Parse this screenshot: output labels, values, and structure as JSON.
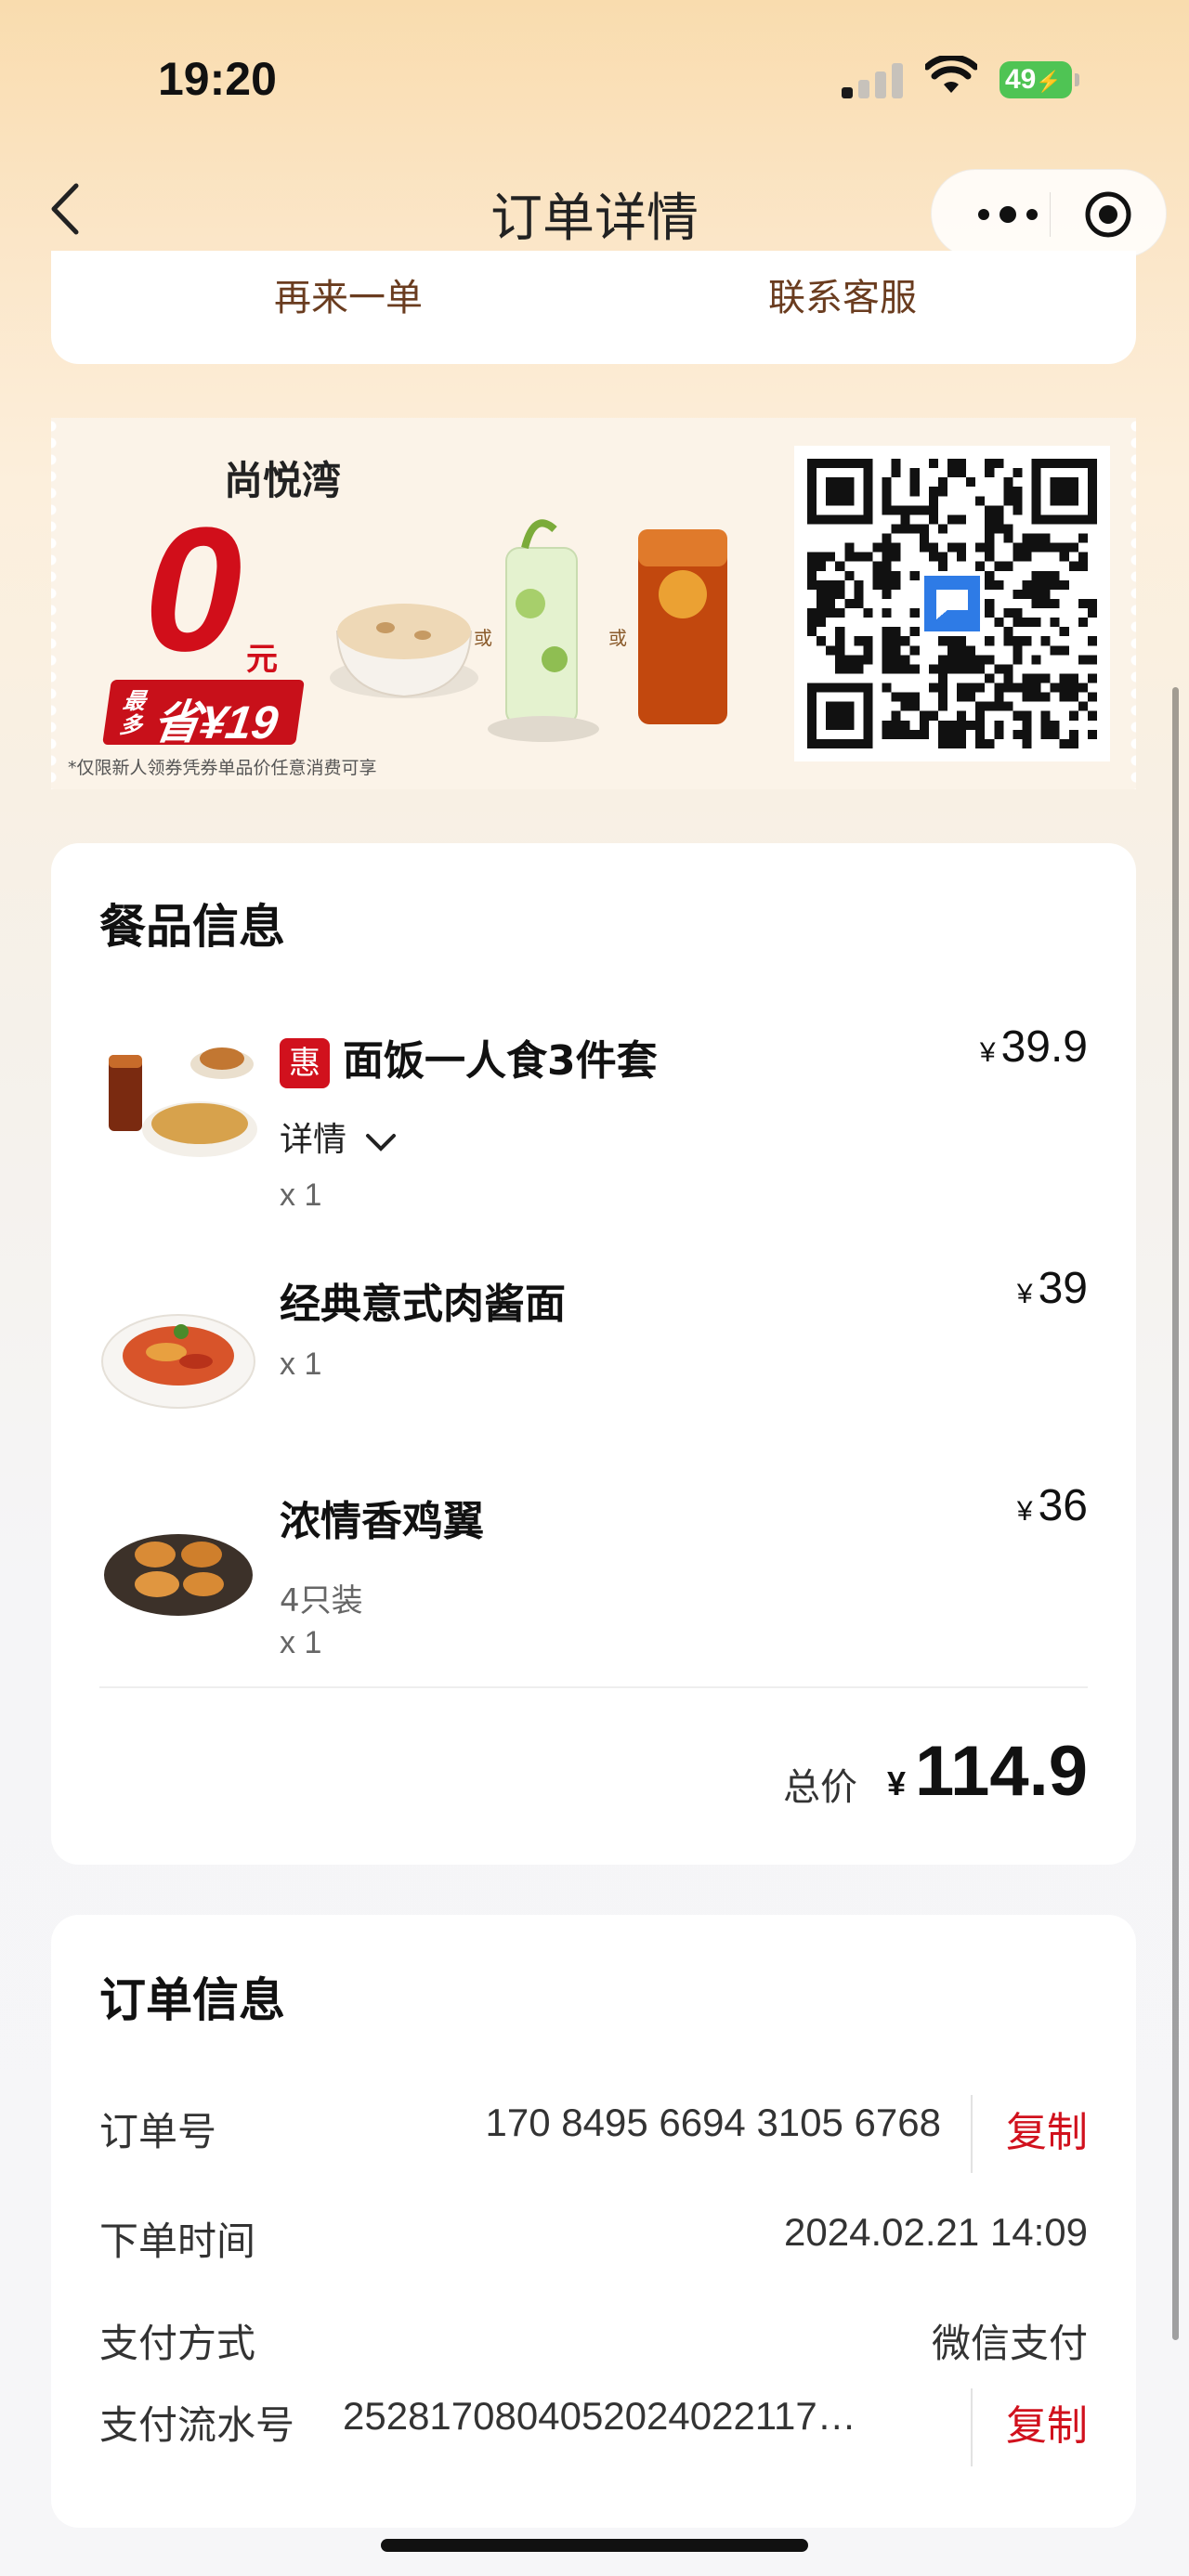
{
  "status_bar": {
    "time": "19:20",
    "battery": "49"
  },
  "nav": {
    "title": "订单详情"
  },
  "actions": {
    "reorder": "再来一单",
    "contact": "联系客服"
  },
  "promo": {
    "store": "尚悦湾",
    "zero": "0",
    "yuan": "元",
    "badge_small": "最多",
    "badge_big": "省¥19",
    "or": "或",
    "note": "*仅限新人领券凭券单品价任意消费可享"
  },
  "products": {
    "title": "餐品信息",
    "currency": "¥",
    "items": [
      {
        "badge": "惠",
        "name": "面饭一人食3件套",
        "price": "39.9",
        "details": "详情",
        "qty": "x 1"
      },
      {
        "name": "经典意式肉酱面",
        "price": "39",
        "qty": "x 1"
      },
      {
        "name": "浓情香鸡翼",
        "spec": "4只装",
        "price": "36",
        "qty": "x 1"
      }
    ],
    "total_label": "总价",
    "total_value": "114.9"
  },
  "order": {
    "title": "订单信息",
    "order_no_label": "订单号",
    "order_no": "170 8495 6694 3105 6768",
    "copy": "复制",
    "time_label": "下单时间",
    "time": "2024.02.21 14:09",
    "pay_label": "支付方式",
    "pay": "微信支付",
    "serial_label": "支付流水号",
    "serial": "2528170804052024022117…"
  }
}
